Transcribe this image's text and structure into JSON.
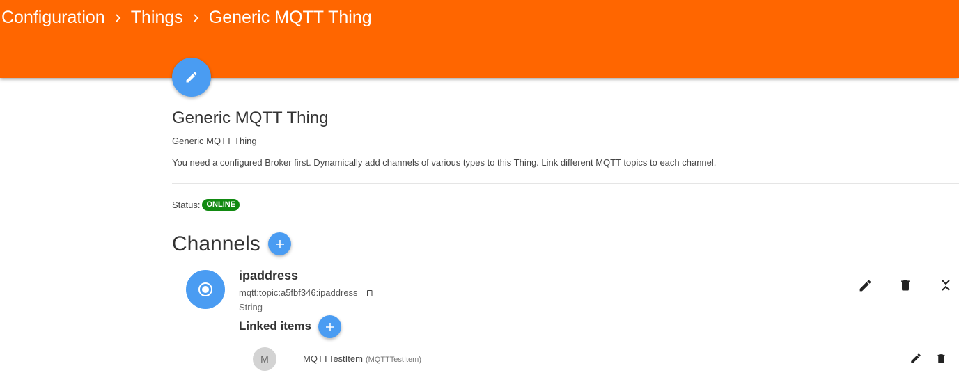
{
  "breadcrumb": {
    "items": [
      "Configuration",
      "Things",
      "Generic MQTT Thing"
    ]
  },
  "thing": {
    "title": "Generic MQTT Thing",
    "subtitle": "Generic MQTT Thing",
    "description": "You need a configured Broker first. Dynamically add channels of various types to this Thing. Link different MQTT topics to each channel.",
    "status_label": "Status:",
    "status_value": "ONLINE"
  },
  "channels": {
    "heading": "Channels",
    "items": [
      {
        "name": "ipaddress",
        "uid": "mqtt:topic:a5fbf346:ipaddress",
        "type": "String",
        "linked_heading": "Linked items",
        "linked_items": [
          {
            "avatar_letter": "M",
            "label": "MQTTTestItem",
            "name": "(MQTTTestItem)"
          }
        ]
      }
    ]
  },
  "icons": {
    "edit_fab": "pencil-icon",
    "add": "plus-icon",
    "channel": "radio-button-icon",
    "copy": "copy-icon",
    "delete": "trash-icon",
    "collapse": "chevron-collapse-icon"
  },
  "colors": {
    "topbar": "#ff6600",
    "accent": "#4a9cf2",
    "status_online": "#128a12"
  }
}
